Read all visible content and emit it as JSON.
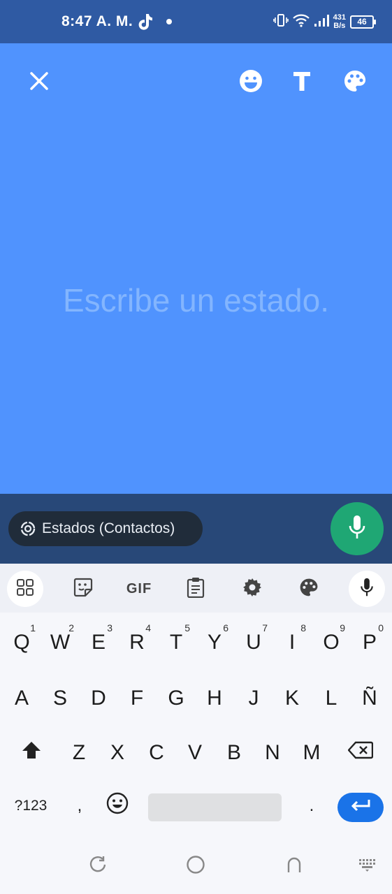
{
  "status_bar": {
    "time": "8:47 A. M.",
    "net_speed_value": "431",
    "net_speed_unit": "B/s",
    "battery": "46",
    "icons": [
      "tiktok-icon",
      "notification-dot",
      "vibrate-icon",
      "wifi-icon",
      "signal-icon",
      "battery-icon"
    ]
  },
  "editor": {
    "placeholder": "Escribe un estado.",
    "background_color": "#5093fe",
    "tools": [
      "close-icon",
      "emoji-icon",
      "text-icon",
      "palette-icon"
    ]
  },
  "composer": {
    "audience_label": "Estados (Contactos)",
    "mic_color": "#1fa774"
  },
  "keyboard": {
    "toolbar": {
      "gif_label": "GIF",
      "icons": [
        "apps-grid-icon",
        "sticker-icon",
        "gif-icon",
        "clipboard-icon",
        "settings-icon",
        "palette-icon",
        "mic-icon"
      ]
    },
    "row1": [
      {
        "k": "Q",
        "h": "1"
      },
      {
        "k": "W",
        "h": "2"
      },
      {
        "k": "E",
        "h": "3"
      },
      {
        "k": "R",
        "h": "4"
      },
      {
        "k": "T",
        "h": "5"
      },
      {
        "k": "Y",
        "h": "6"
      },
      {
        "k": "U",
        "h": "7"
      },
      {
        "k": "I",
        "h": "8"
      },
      {
        "k": "O",
        "h": "9"
      },
      {
        "k": "P",
        "h": "0"
      }
    ],
    "row2": [
      "A",
      "S",
      "D",
      "F",
      "G",
      "H",
      "J",
      "K",
      "L",
      "Ñ"
    ],
    "row3": [
      "Z",
      "X",
      "C",
      "V",
      "B",
      "N",
      "M"
    ],
    "row4": {
      "symbols_label": "?123",
      "comma": ",",
      "period": "."
    },
    "enter_color": "#1a73e8"
  },
  "nav_bar": {
    "icons": [
      "rotate-icon",
      "home-icon",
      "back-icon",
      "keyboard-switch-icon"
    ]
  }
}
